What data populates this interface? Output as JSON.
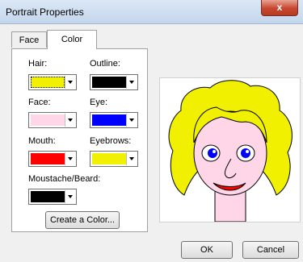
{
  "window": {
    "title": "Portrait Properties",
    "close_label": "x"
  },
  "tabs": [
    {
      "label": "Face"
    },
    {
      "label": "Color"
    }
  ],
  "colors": {
    "hair": {
      "label": "Hair:",
      "value": "#f0f000",
      "selected": true
    },
    "outline": {
      "label": "Outline:",
      "value": "#000000"
    },
    "face": {
      "label": "Face:",
      "value": "#ffd6e8"
    },
    "eye": {
      "label": "Eye:",
      "value": "#0000ff"
    },
    "mouth": {
      "label": "Mouth:",
      "value": "#ff0000"
    },
    "eyebrows": {
      "label": "Eyebrows:",
      "value": "#f0f000"
    },
    "moustache": {
      "label": "Moustache/Beard:",
      "value": "#000000"
    }
  },
  "buttons": {
    "create_color": "Create a Color...",
    "ok": "OK",
    "cancel": "Cancel"
  }
}
